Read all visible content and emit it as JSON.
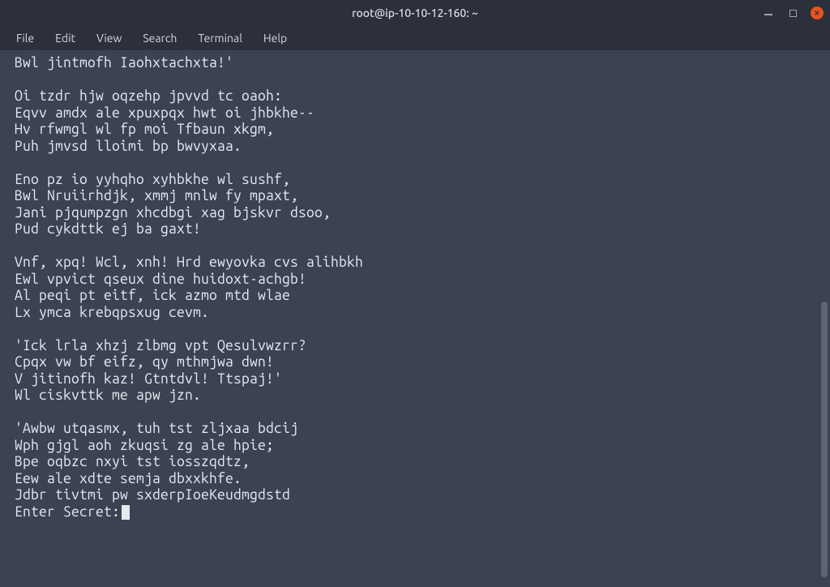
{
  "window": {
    "title": "root@ip-10-10-12-160: ~"
  },
  "menubar": {
    "items": [
      {
        "label": "File"
      },
      {
        "label": "Edit"
      },
      {
        "label": "View"
      },
      {
        "label": "Search"
      },
      {
        "label": "Terminal"
      },
      {
        "label": "Help"
      }
    ]
  },
  "terminal": {
    "output": "Bwl jintmofh Iaohxtachxta!'\n\nOi tzdr hjw oqzehp jpvvd tc oaoh:\nEqvv amdx ale xpuxpqx hwt oi jhbkhe--\nHv rfwmgl wl fp moi Tfbaun xkgm,\nPuh jmvsd lloimi bp bwvyxaa.\n\nEno pz io yyhqho xyhbkhe wl sushf,\nBwl Nruiirhdjk, xmmj mnlw fy mpaxt,\nJani pjqumpzgn xhcdbgi xag bjskvr dsoo,\nPud cykdttk ej ba gaxt!\n\nVnf, xpq! Wcl, xnh! Hrd ewyovka cvs alihbkh\nEwl vpvict qseux dine huidoxt-achgb!\nAl peqi pt eitf, ick azmo mtd wlae\nLx ymca krebqpsxug cevm.\n\n'Ick lrla xhzj zlbmg vpt Qesulvwzrr?\nCpqx vw bf eifz, qy mthmjwa dwn!\nV jitinofh kaz! Gtntdvl! Ttspaj!'\nWl ciskvttk me apw jzn.\n\n'Awbw utqasmx, tuh tst zljxaa bdcij\nWph gjgl aoh zkuqsi zg ale hpie;\nBpe oqbzc nxyi tst iosszqdtz,\nEew ale xdte semja dbxxkhfe.\nJdbr tivtmi pw sxderpIoeKeudmgdstd",
    "prompt": "Enter Secret:"
  }
}
